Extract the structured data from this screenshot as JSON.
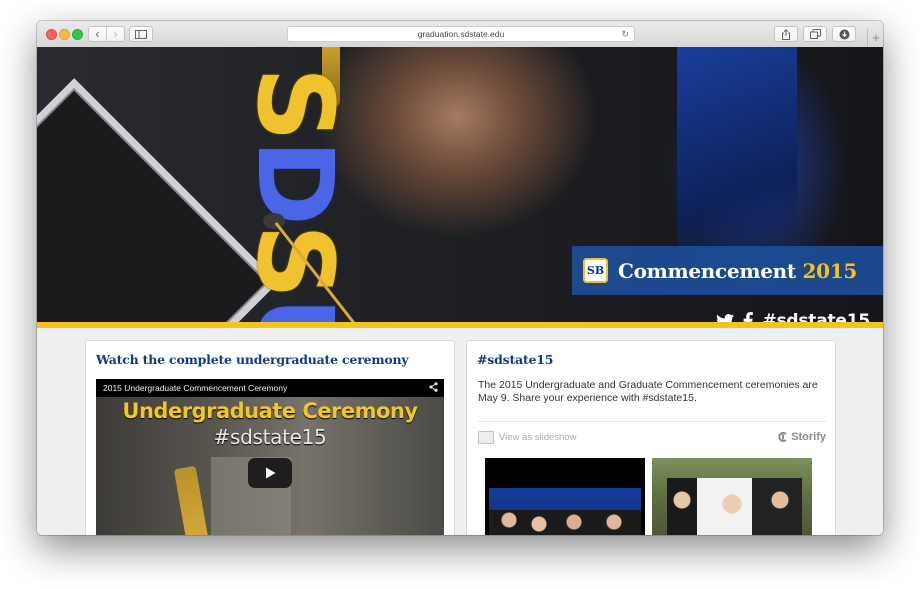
{
  "browser": {
    "url": "graduation.sdstate.edu",
    "buttons": {
      "back": "‹",
      "forward": "›",
      "sidebar_icon": "sidebar-icon",
      "share_icon": "share-icon",
      "tabs_icon": "tabs-icon",
      "downloads_icon": "downloads-icon",
      "new_tab": "+"
    }
  },
  "hero": {
    "banner_title": "Commencement",
    "banner_year": "2015",
    "logo_text": "SB",
    "hashtag": "#sdstate15",
    "cap_letters": [
      "S",
      "D",
      "S",
      "U"
    ],
    "colors": {
      "blue": "#1d52a0",
      "gold": "#f6c31c"
    }
  },
  "video_card": {
    "heading": "Watch the complete undergraduate ceremony",
    "video_title": "2015 Undergraduate Commencement Ceremony",
    "overlay_line1": "Undergraduate Ceremony",
    "overlay_line2": "#sdstate15"
  },
  "storify_card": {
    "heading": "#sdstate15",
    "description": "The 2015 Undergraduate and Graduate Commencement ceremonies are May 9. Share your experience with #sdstate15.",
    "slideshow_label": "View as slideshow",
    "brand": "Storify"
  }
}
